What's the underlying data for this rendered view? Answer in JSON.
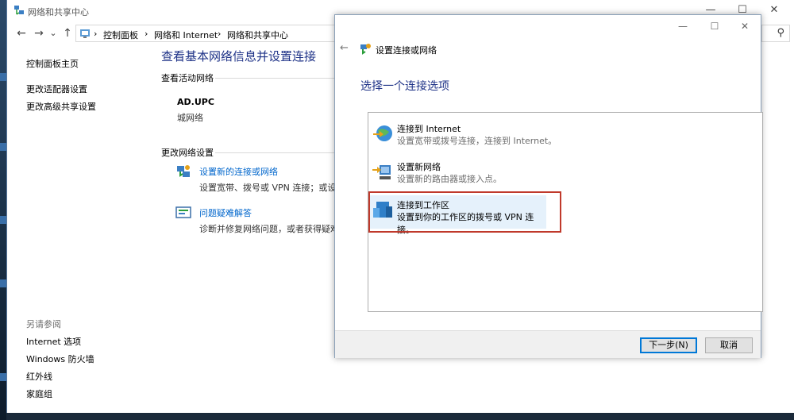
{
  "main_window": {
    "title": "网络和共享中心",
    "controls": {
      "minimize": "—",
      "maximize": "☐",
      "close": "✕"
    }
  },
  "address_bar": {
    "back": "←",
    "forward": "→",
    "recent": "⌄",
    "up": "↑",
    "separator": "›",
    "breadcrumbs": [
      "控制面板",
      "网络和 Internet",
      "网络和共享中心"
    ],
    "search_icon": "⚲"
  },
  "left_pane": {
    "links": [
      "控制面板主页",
      "更改适配器设置",
      "更改高级共享设置"
    ],
    "see_also_heading": "另请参阅",
    "see_also": [
      "Internet 选项",
      "Windows 防火墙",
      "红外线",
      "家庭组"
    ]
  },
  "content": {
    "title": "查看基本网络信息并设置连接",
    "active_networks_heading": "查看活动网络",
    "network_name": "AD.UPC",
    "network_type": "城网络",
    "change_settings_heading": "更改网络设置",
    "tasks": [
      {
        "link": "设置新的连接或网络",
        "desc": "设置宽带、拨号或 VPN 连接；或设置",
        "icon": "network-setup-icon"
      },
      {
        "link": "问题疑难解答",
        "desc": "诊断并修复网络问题，或者获得疑难",
        "icon": "troubleshoot-icon"
      }
    ]
  },
  "dialog": {
    "header_title": "设置连接或网络",
    "back": "←",
    "heading": "选择一个连接选项",
    "controls": {
      "minimize": "—",
      "maximize": "☐",
      "close": "✕"
    },
    "options": [
      {
        "title": "连接到 Internet",
        "desc": "设置宽带或拨号连接，连接到 Internet。",
        "icon": "globe-icon"
      },
      {
        "title": "设置新网络",
        "desc": "设置新的路由器或接入点。",
        "icon": "router-icon"
      },
      {
        "title": "连接到工作区",
        "desc": "设置到你的工作区的拨号或 VPN 连接。",
        "icon": "workplace-icon"
      }
    ],
    "selected_option": 2,
    "buttons": {
      "next": "下一步(N)",
      "cancel": "取消"
    }
  },
  "colors": {
    "link": "#0066cc",
    "heading": "#1e3287",
    "highlight_border": "#c0392b",
    "selection_bg": "#e5f1fb"
  }
}
